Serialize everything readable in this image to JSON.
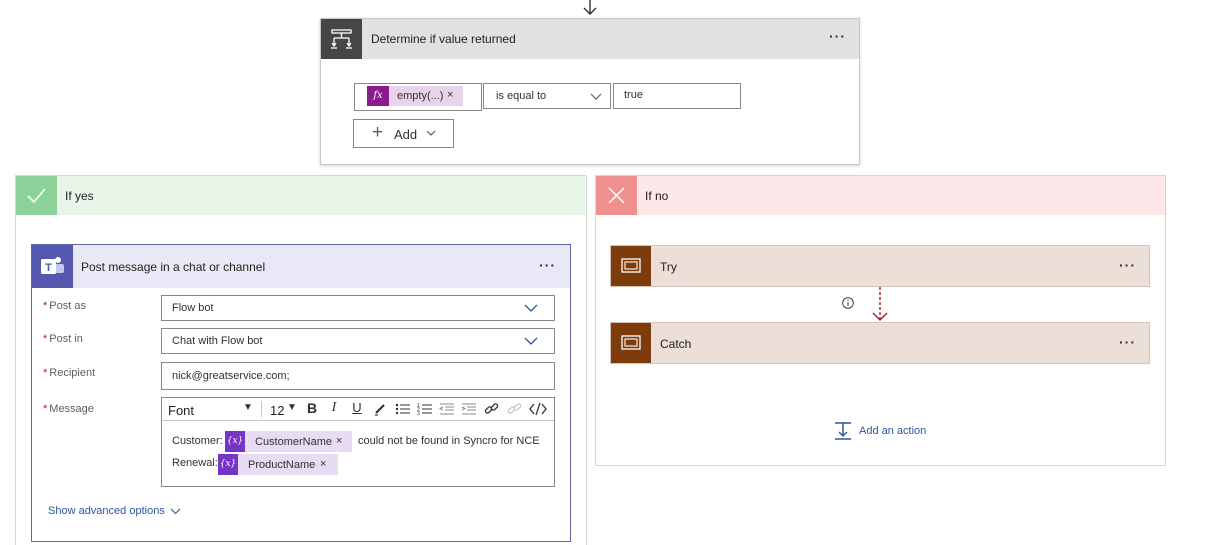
{
  "condition": {
    "title": "Determine if value returned",
    "expression_token": "empty(...)",
    "operator": "is equal to",
    "value": "true",
    "add_label": "Add"
  },
  "if_yes": {
    "title": "If yes",
    "action": {
      "title": "Post message in a chat or channel",
      "fields": {
        "post_as_label": "Post as",
        "post_as_value": "Flow bot",
        "post_in_label": "Post in",
        "post_in_value": "Chat with Flow bot",
        "recipient_label": "Recipient",
        "recipient_value": "nick@greatservice.com;",
        "message_label": "Message",
        "required_mark": "*"
      },
      "editor": {
        "font": "Font",
        "size": "12",
        "line1_prefix": "Customer:",
        "token1": "CustomerName",
        "line1_suffix": "could not be found in Syncro for NCE",
        "line2_prefix": "Renewal:",
        "token2": "ProductName",
        "var_icon": "{x}"
      },
      "show_advanced": "Show advanced options"
    }
  },
  "if_no": {
    "title": "If no",
    "try_label": "Try",
    "catch_label": "Catch",
    "add_action": "Add an action"
  },
  "colors": {
    "condition_icon_bg": "#484644",
    "yes_accent": "#8dd19a",
    "no_accent": "#f0918f",
    "teams_accent": "#5558af",
    "scope_accent": "#7e3c0d",
    "fx_accent": "#8c1c8e",
    "variable_accent": "#7735c8",
    "link": "#2b579a"
  }
}
